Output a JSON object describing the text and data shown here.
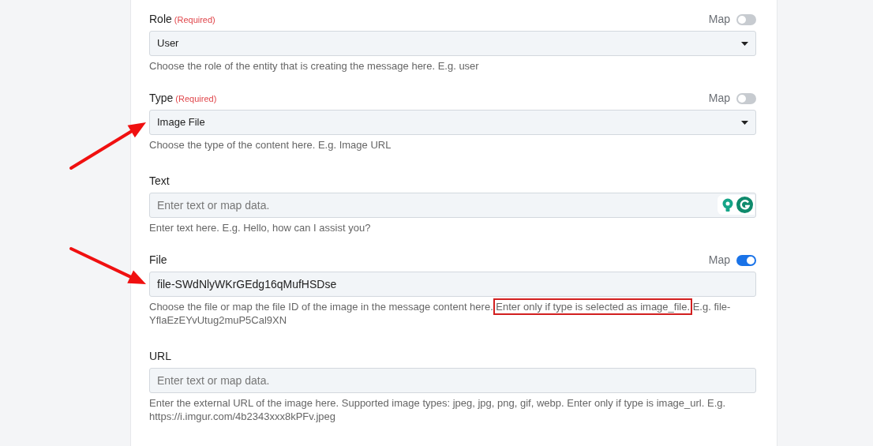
{
  "fields": [
    {
      "label": "Role",
      "required_text": "(Required)",
      "map": {
        "label": "Map",
        "on": false
      },
      "kind": "select",
      "value": "User",
      "help": {
        "before": "Choose the role of the entity that is creating the message here. E.g. user"
      }
    },
    {
      "label": "Type",
      "required_text": "(Required)",
      "map": {
        "label": "Map",
        "on": false
      },
      "kind": "select",
      "value": "Image File",
      "arrow": true,
      "help": {
        "before": "Choose the type of the content here. E.g. Image URL"
      }
    },
    {
      "label": "Text",
      "kind": "assisted_input",
      "placeholder": "Enter text or map data.",
      "help": {
        "before": "Enter text here. E.g. Hello, how can I assist you?"
      }
    },
    {
      "label": "File",
      "map": {
        "label": "Map",
        "on": true
      },
      "kind": "input",
      "value": "file-SWdNlyWKrGEdg16qMufHSDse",
      "arrow": true,
      "help": {
        "before": "Choose the file or map the file ID of the image in the message content here.",
        "highlight": "Enter only if type is selected as image_file.",
        "after": "E.g. file-YflaEzEYvUtug2muP5Cal9XN"
      }
    },
    {
      "label": "URL",
      "kind": "input",
      "placeholder": "Enter text or map data.",
      "help": {
        "before": "Enter the external URL of the image here. Supported image types: jpeg, jpg, png, gif, webp. Enter only if type is image_url. E.g. https://i.imgur.com/4b2343xxx8kPFv.jpeg"
      }
    }
  ]
}
